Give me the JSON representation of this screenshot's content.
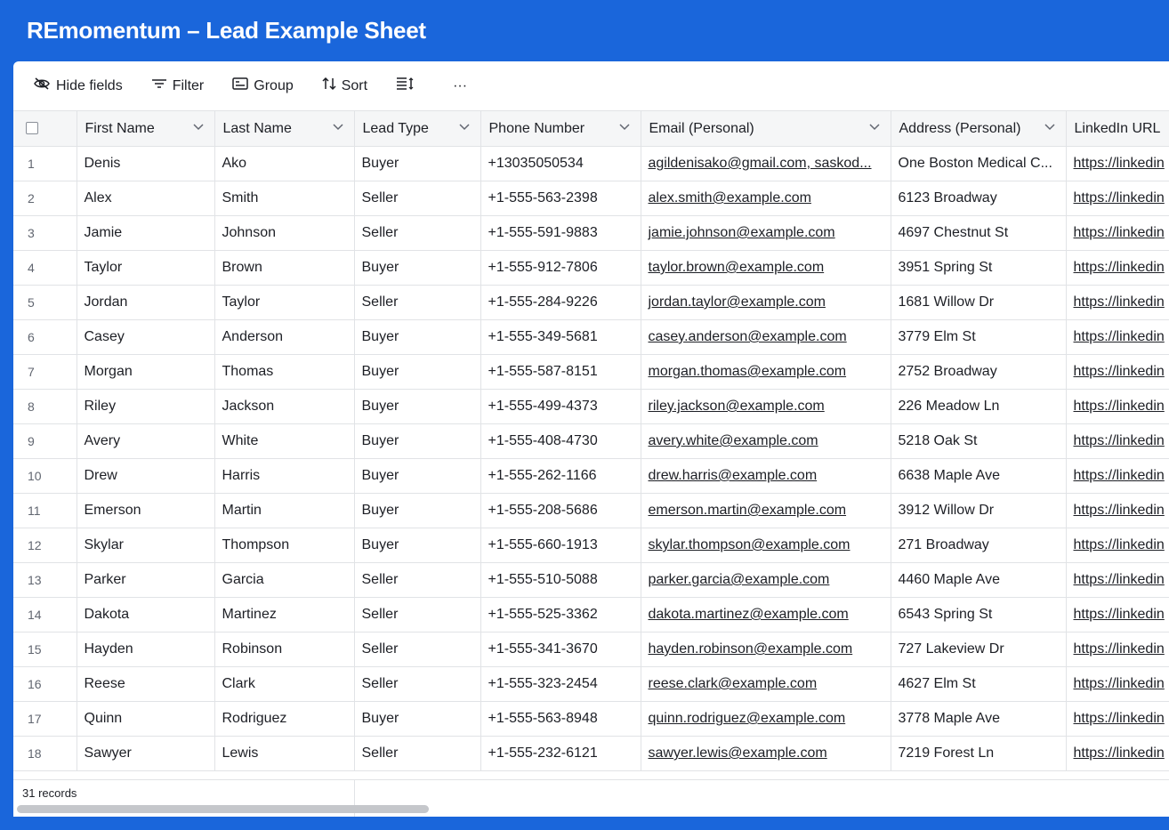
{
  "app": {
    "title": "REmomentum – Lead Example Sheet"
  },
  "toolbar": {
    "hide_fields": "Hide fields",
    "filter": "Filter",
    "group": "Group",
    "sort": "Sort",
    "more": "···"
  },
  "columns": [
    "First Name",
    "Last Name",
    "Lead Type",
    "Phone Number",
    "Email (Personal)",
    "Address (Personal)",
    "LinkedIn URL"
  ],
  "rows": [
    {
      "n": "1",
      "first": "Denis",
      "last": "Ako",
      "type": "Buyer",
      "phone": "+13035050534",
      "email": "agildenisako@gmail.com, saskod...",
      "address": "One Boston Medical C...",
      "linkedin": "https://linkedin"
    },
    {
      "n": "2",
      "first": "Alex",
      "last": "Smith",
      "type": "Seller",
      "phone": "+1-555-563-2398",
      "email": "alex.smith@example.com",
      "address": "6123 Broadway",
      "linkedin": "https://linkedin"
    },
    {
      "n": "3",
      "first": "Jamie",
      "last": "Johnson",
      "type": "Seller",
      "phone": "+1-555-591-9883",
      "email": "jamie.johnson@example.com",
      "address": "4697 Chestnut St",
      "linkedin": "https://linkedin"
    },
    {
      "n": "4",
      "first": "Taylor",
      "last": "Brown",
      "type": "Buyer",
      "phone": "+1-555-912-7806",
      "email": "taylor.brown@example.com",
      "address": "3951 Spring St",
      "linkedin": "https://linkedin"
    },
    {
      "n": "5",
      "first": "Jordan",
      "last": "Taylor",
      "type": "Seller",
      "phone": "+1-555-284-9226",
      "email": "jordan.taylor@example.com",
      "address": "1681 Willow Dr",
      "linkedin": "https://linkedin"
    },
    {
      "n": "6",
      "first": "Casey",
      "last": "Anderson",
      "type": "Buyer",
      "phone": "+1-555-349-5681",
      "email": "casey.anderson@example.com",
      "address": "3779 Elm St",
      "linkedin": "https://linkedin"
    },
    {
      "n": "7",
      "first": "Morgan",
      "last": "Thomas",
      "type": "Buyer",
      "phone": "+1-555-587-8151",
      "email": "morgan.thomas@example.com",
      "address": "2752 Broadway",
      "linkedin": "https://linkedin"
    },
    {
      "n": "8",
      "first": "Riley",
      "last": "Jackson",
      "type": "Buyer",
      "phone": "+1-555-499-4373",
      "email": "riley.jackson@example.com",
      "address": "226 Meadow Ln",
      "linkedin": "https://linkedin"
    },
    {
      "n": "9",
      "first": "Avery",
      "last": "White",
      "type": "Buyer",
      "phone": "+1-555-408-4730",
      "email": "avery.white@example.com",
      "address": "5218 Oak St",
      "linkedin": "https://linkedin"
    },
    {
      "n": "10",
      "first": "Drew",
      "last": "Harris",
      "type": "Buyer",
      "phone": "+1-555-262-1166",
      "email": "drew.harris@example.com",
      "address": "6638 Maple Ave",
      "linkedin": "https://linkedin"
    },
    {
      "n": "11",
      "first": "Emerson",
      "last": "Martin",
      "type": "Buyer",
      "phone": "+1-555-208-5686",
      "email": "emerson.martin@example.com",
      "address": "3912 Willow Dr",
      "linkedin": "https://linkedin"
    },
    {
      "n": "12",
      "first": "Skylar",
      "last": "Thompson",
      "type": "Buyer",
      "phone": "+1-555-660-1913",
      "email": "skylar.thompson@example.com",
      "address": "271 Broadway",
      "linkedin": "https://linkedin"
    },
    {
      "n": "13",
      "first": "Parker",
      "last": "Garcia",
      "type": "Seller",
      "phone": "+1-555-510-5088",
      "email": "parker.garcia@example.com",
      "address": "4460 Maple Ave",
      "linkedin": "https://linkedin"
    },
    {
      "n": "14",
      "first": "Dakota",
      "last": "Martinez",
      "type": "Seller",
      "phone": "+1-555-525-3362",
      "email": "dakota.martinez@example.com",
      "address": "6543 Spring St",
      "linkedin": "https://linkedin"
    },
    {
      "n": "15",
      "first": "Hayden",
      "last": "Robinson",
      "type": "Seller",
      "phone": "+1-555-341-3670",
      "email": "hayden.robinson@example.com",
      "address": "727 Lakeview Dr",
      "linkedin": "https://linkedin"
    },
    {
      "n": "16",
      "first": "Reese",
      "last": "Clark",
      "type": "Seller",
      "phone": "+1-555-323-2454",
      "email": "reese.clark@example.com",
      "address": "4627 Elm St",
      "linkedin": "https://linkedin"
    },
    {
      "n": "17",
      "first": "Quinn",
      "last": "Rodriguez",
      "type": "Buyer",
      "phone": "+1-555-563-8948",
      "email": "quinn.rodriguez@example.com",
      "address": "3778 Maple Ave",
      "linkedin": "https://linkedin"
    },
    {
      "n": "18",
      "first": "Sawyer",
      "last": "Lewis",
      "type": "Seller",
      "phone": "+1-555-232-6121",
      "email": "sawyer.lewis@example.com",
      "address": "7219 Forest Ln",
      "linkedin": "https://linkedin"
    }
  ],
  "footer": {
    "record_count": "31 records"
  },
  "icons": {
    "hide_fields": "eye-slash-icon",
    "filter": "filter-icon",
    "group": "group-icon",
    "sort": "sort-icon",
    "row_height": "row-height-icon",
    "more": "more-icon",
    "column_menu": "chevron-down-icon"
  },
  "colors": {
    "header_bar": "#1a66db",
    "grid_header": "#f5f6f7",
    "border": "#e1e3e6"
  }
}
